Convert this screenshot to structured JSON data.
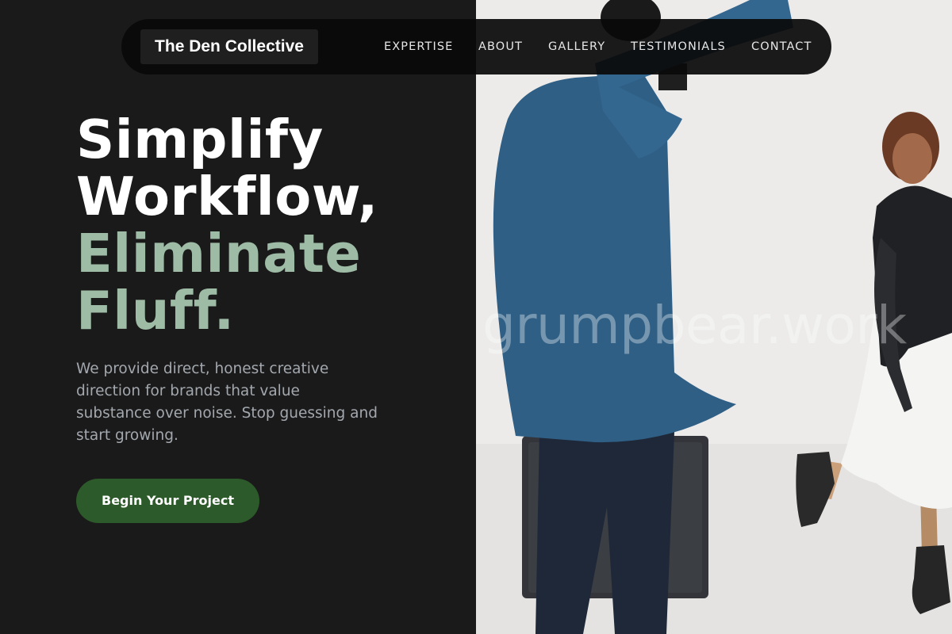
{
  "nav": {
    "brand": "The Den Collective",
    "links": [
      "EXPERTISE",
      "ABOUT",
      "GALLERY",
      "TESTIMONIALS",
      "CONTACT"
    ]
  },
  "hero": {
    "headline_line1": "Simplify",
    "headline_line2": "Workflow,",
    "headline_line3": "Eliminate",
    "headline_line4": "Fluff.",
    "description": "We provide direct, honest creative direction for brands that value substance over noise. Stop guessing and start growing.",
    "cta_label": "Begin Your Project"
  },
  "photo": {
    "watermark": "grumpbear.work"
  },
  "colors": {
    "background": "#1a1a1a",
    "accent_green_text": "#9dbba5",
    "cta_green": "#2d5a2a",
    "muted_text": "#a3a8ae"
  }
}
